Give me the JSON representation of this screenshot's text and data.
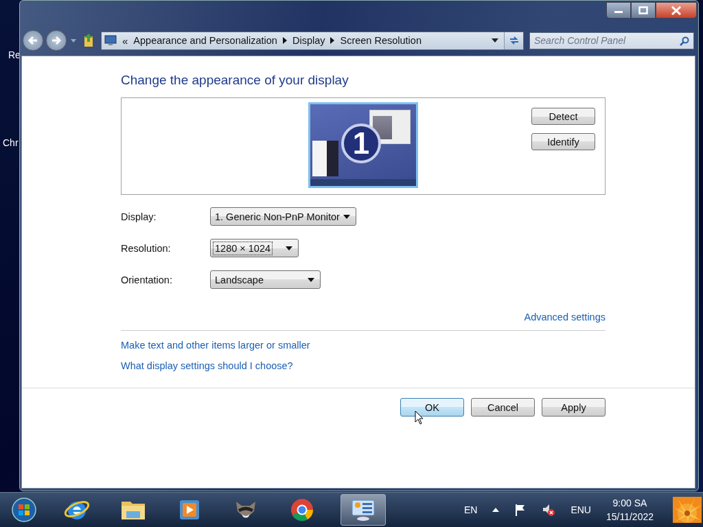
{
  "desktop_icons": [
    {
      "label": "Re"
    },
    {
      "label": "Chr"
    }
  ],
  "window": {
    "overflow": "«",
    "breadcrumb": [
      "Appearance and Personalization",
      "Display",
      "Screen Resolution"
    ],
    "search": {
      "placeholder": "Search Control Panel"
    }
  },
  "heading": "Change the appearance of your display",
  "monitor": {
    "number": "1"
  },
  "side_buttons": [
    "Detect",
    "Identify"
  ],
  "settings": [
    {
      "label": "Display:",
      "value": "1. Generic Non-PnP Monitor",
      "focused": false
    },
    {
      "label": "Resolution:",
      "value": "1280 × 1024",
      "focused": true
    },
    {
      "label": "Orientation:",
      "value": "Landscape",
      "focused": false
    }
  ],
  "advanced_link": "Advanced settings",
  "links": [
    "Make text and other items larger or smaller",
    "What display settings should I choose?"
  ],
  "buttons": [
    {
      "label": "OK",
      "default": true
    },
    {
      "label": "Cancel",
      "default": false
    },
    {
      "label": "Apply",
      "default": false
    }
  ],
  "taskbar": {
    "apps": [
      {
        "kind": "browser",
        "active": false
      },
      {
        "kind": "folder",
        "active": false
      },
      {
        "kind": "player",
        "active": false
      },
      {
        "kind": "raccoon",
        "active": false
      },
      {
        "kind": "ring",
        "active": false
      },
      {
        "kind": "panel",
        "active": true
      }
    ],
    "language": "EN",
    "input": "ENU",
    "time": "9:00 SA",
    "date": "15/11/2022"
  }
}
